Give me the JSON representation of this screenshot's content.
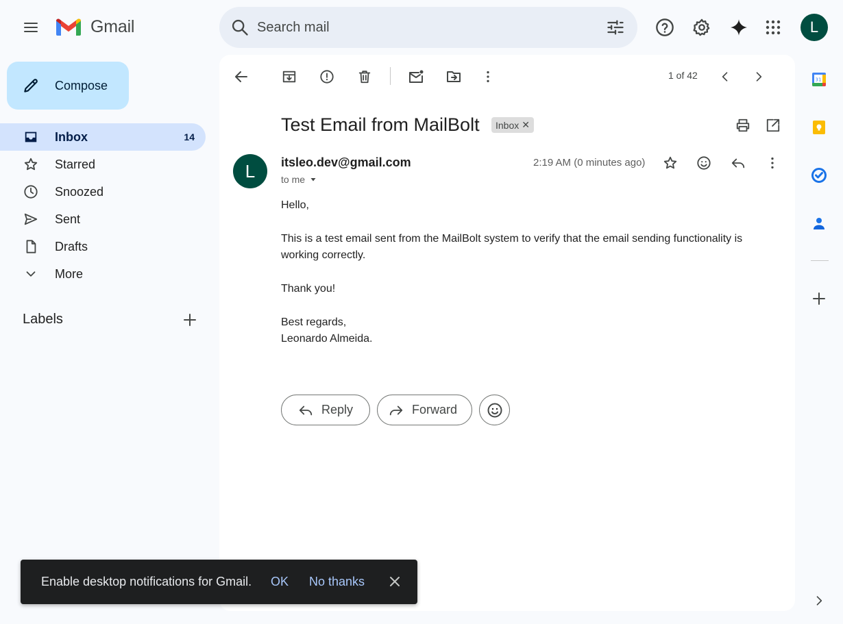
{
  "header": {
    "app_name": "Gmail",
    "search_placeholder": "Search mail",
    "account_initial": "L"
  },
  "sidebar": {
    "compose_label": "Compose",
    "items": [
      {
        "label": "Inbox",
        "count": "14",
        "icon": "inbox-icon",
        "active": true
      },
      {
        "label": "Starred",
        "count": "",
        "icon": "star-icon"
      },
      {
        "label": "Snoozed",
        "count": "",
        "icon": "clock-icon"
      },
      {
        "label": "Sent",
        "count": "",
        "icon": "send-icon"
      },
      {
        "label": "Drafts",
        "count": "",
        "icon": "file-icon"
      },
      {
        "label": "More",
        "count": "",
        "icon": "chevron-down-icon"
      }
    ],
    "labels_heading": "Labels"
  },
  "toolbar": {
    "pager": "1 of 42"
  },
  "email": {
    "subject": "Test Email from MailBolt",
    "label_chip": "Inbox",
    "sender": "itsleo.dev@gmail.com",
    "sender_initial": "L",
    "recipient": "to me",
    "time": "2:19 AM (0 minutes ago)",
    "body": {
      "greeting": "Hello,",
      "paragraph": "This is a test email sent from the MailBolt system to verify that the email sending functionality is working correctly.",
      "thanks": "Thank you!",
      "signoff": "Best regards,\nLeonardo Almeida."
    },
    "reply_label": "Reply",
    "forward_label": "Forward"
  },
  "toast": {
    "message": "Enable desktop notifications for Gmail.",
    "ok_label": "OK",
    "no_label": "No thanks"
  },
  "colors": {
    "accent": "#c2e7ff",
    "active_nav": "#d3e3fd",
    "avatar": "#004d40",
    "link_blue": "#a8c7fa"
  }
}
